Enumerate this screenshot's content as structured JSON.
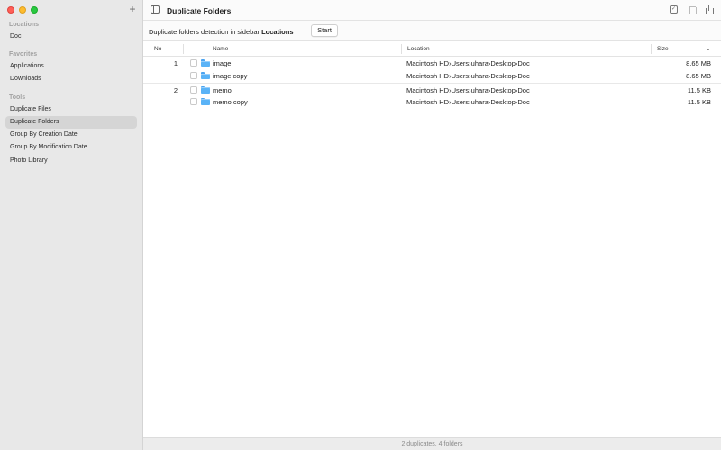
{
  "sidebar": {
    "add_label": "+",
    "sections": [
      {
        "title": "Locations",
        "items": [
          {
            "label": "Doc",
            "selected": false
          }
        ]
      },
      {
        "title": "Favorites",
        "items": [
          {
            "label": "Applications",
            "selected": false
          },
          {
            "label": "Downloads",
            "selected": false
          }
        ]
      },
      {
        "title": "Tools",
        "items": [
          {
            "label": "Duplicate Files",
            "selected": false
          },
          {
            "label": "Duplicate Folders",
            "selected": true
          },
          {
            "label": "Group By Creation Date",
            "selected": false
          },
          {
            "label": "Group By Modification Date",
            "selected": false
          },
          {
            "label": "Photo Library",
            "selected": false
          }
        ]
      }
    ]
  },
  "header": {
    "title": "Duplicate Folders"
  },
  "toolbar": {
    "detect_prefix": "Duplicate folders detection in sidebar ",
    "detect_bold": "Locations",
    "start_label": "Start"
  },
  "table": {
    "columns": {
      "no": "No",
      "name": "Name",
      "location": "Location",
      "size": "Size"
    },
    "rows": [
      {
        "no": "1",
        "name": "image",
        "location": "Macintosh HD›Users›uhara›Desktop›Doc",
        "size": "8.65 MB"
      },
      {
        "no": "",
        "name": "image copy",
        "location": "Macintosh HD›Users›uhara›Desktop›Doc",
        "size": "8.65 MB"
      },
      {
        "no": "2",
        "name": "memo",
        "location": "Macintosh HD›Users›uhara›Desktop›Doc",
        "size": "11.5 KB"
      },
      {
        "no": "",
        "name": "memo copy",
        "location": "Macintosh HD›Users›uhara›Desktop›Doc",
        "size": "11.5 KB"
      }
    ]
  },
  "status": {
    "text": "2 duplicates, 4 folders"
  },
  "icons": {
    "folder": "folder-icon",
    "sidebar_toggle": "sidebar-toggle-icon",
    "check": "checkmark-square-icon",
    "trash": "trash-icon",
    "share": "share-icon"
  },
  "colors": {
    "folder": "#5ab3f7",
    "sidebar_bg": "#e8e8e8",
    "selected_bg": "#d5d5d5"
  }
}
